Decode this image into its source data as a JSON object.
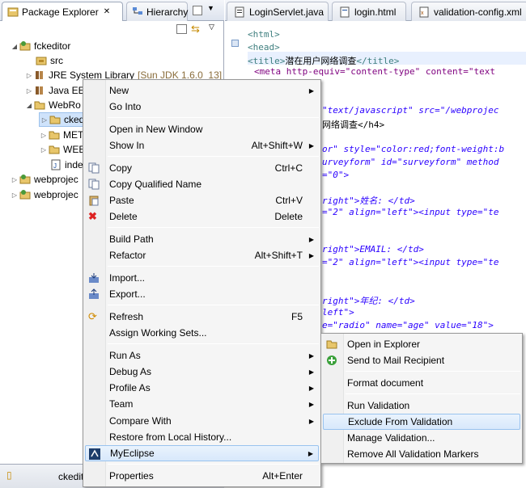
{
  "left_tabs": {
    "package_explorer": "Package Explorer",
    "hierarchy": "Hierarchy"
  },
  "tree": {
    "project": "fckeditor",
    "src": "src",
    "jre_label": "JRE System Library",
    "jre_detail": "[Sun JDK 1.6.0_13]",
    "java_ee": "Java EE",
    "webroot": "WebRo",
    "ckeditor": "cked",
    "meta": "MET",
    "webinf": "WEE",
    "index": "inde",
    "webproject1": "webprojec",
    "webproject2": "webprojec"
  },
  "bottom": {
    "label": "ckedit"
  },
  "editor_tabs": {
    "tab1": "LoginServlet.java",
    "tab2": "login.html",
    "tab3": "validation-config.xml"
  },
  "code": {
    "l1": "<html>",
    "l2": "<head>",
    "l3_title_open": "<title>",
    "l3_title_text": "潜在用户网络调查",
    "l3_title_close": "</title>",
    "l4": "<meta http-equiv=\"content-type\" content=\"text",
    "l5": "\"text/javascript\" src=\"/webprojec",
    "l6": "网络调查</h4>",
    "l7": "or\" style=\"color:red;font-weight:b",
    "l8": "urveyform\" id=\"surveyform\" method",
    "l9": "=\"0\">",
    "l10": "right\">姓名: </td>",
    "l11": "=\"2\" align=\"left\"><input type=\"te",
    "l12": "right\">EMAIL: </td>",
    "l13": "=\"2\" align=\"left\"><input type=\"te",
    "l14": "right\">年纪: </td>",
    "l15": "left\">",
    "l16": "e=\"radio\" name=\"age\" value=\"18\">"
  },
  "context_menu": {
    "new": "New",
    "go_into": "Go Into",
    "open_new_window": "Open in New Window",
    "show_in": "Show In",
    "show_in_acc": "Alt+Shift+W",
    "copy": "Copy",
    "copy_acc": "Ctrl+C",
    "copy_qualified": "Copy Qualified Name",
    "paste": "Paste",
    "paste_acc": "Ctrl+V",
    "delete": "Delete",
    "delete_acc": "Delete",
    "build_path": "Build Path",
    "refactor": "Refactor",
    "refactor_acc": "Alt+Shift+T",
    "import": "Import...",
    "export": "Export...",
    "refresh": "Refresh",
    "refresh_acc": "F5",
    "assign_working_sets": "Assign Working Sets...",
    "run_as": "Run As",
    "debug_as": "Debug As",
    "profile_as": "Profile As",
    "team": "Team",
    "compare_with": "Compare With",
    "restore_history": "Restore from Local History...",
    "myeclipse": "MyEclipse",
    "properties": "Properties",
    "properties_acc": "Alt+Enter"
  },
  "submenu": {
    "open_explorer": "Open in Explorer",
    "send_mail": "Send to Mail Recipient",
    "format_document": "Format document",
    "run_validation": "Run Validation",
    "exclude_validation": "Exclude From Validation",
    "manage_validation": "Manage Validation...",
    "remove_markers": "Remove All Validation Markers"
  }
}
